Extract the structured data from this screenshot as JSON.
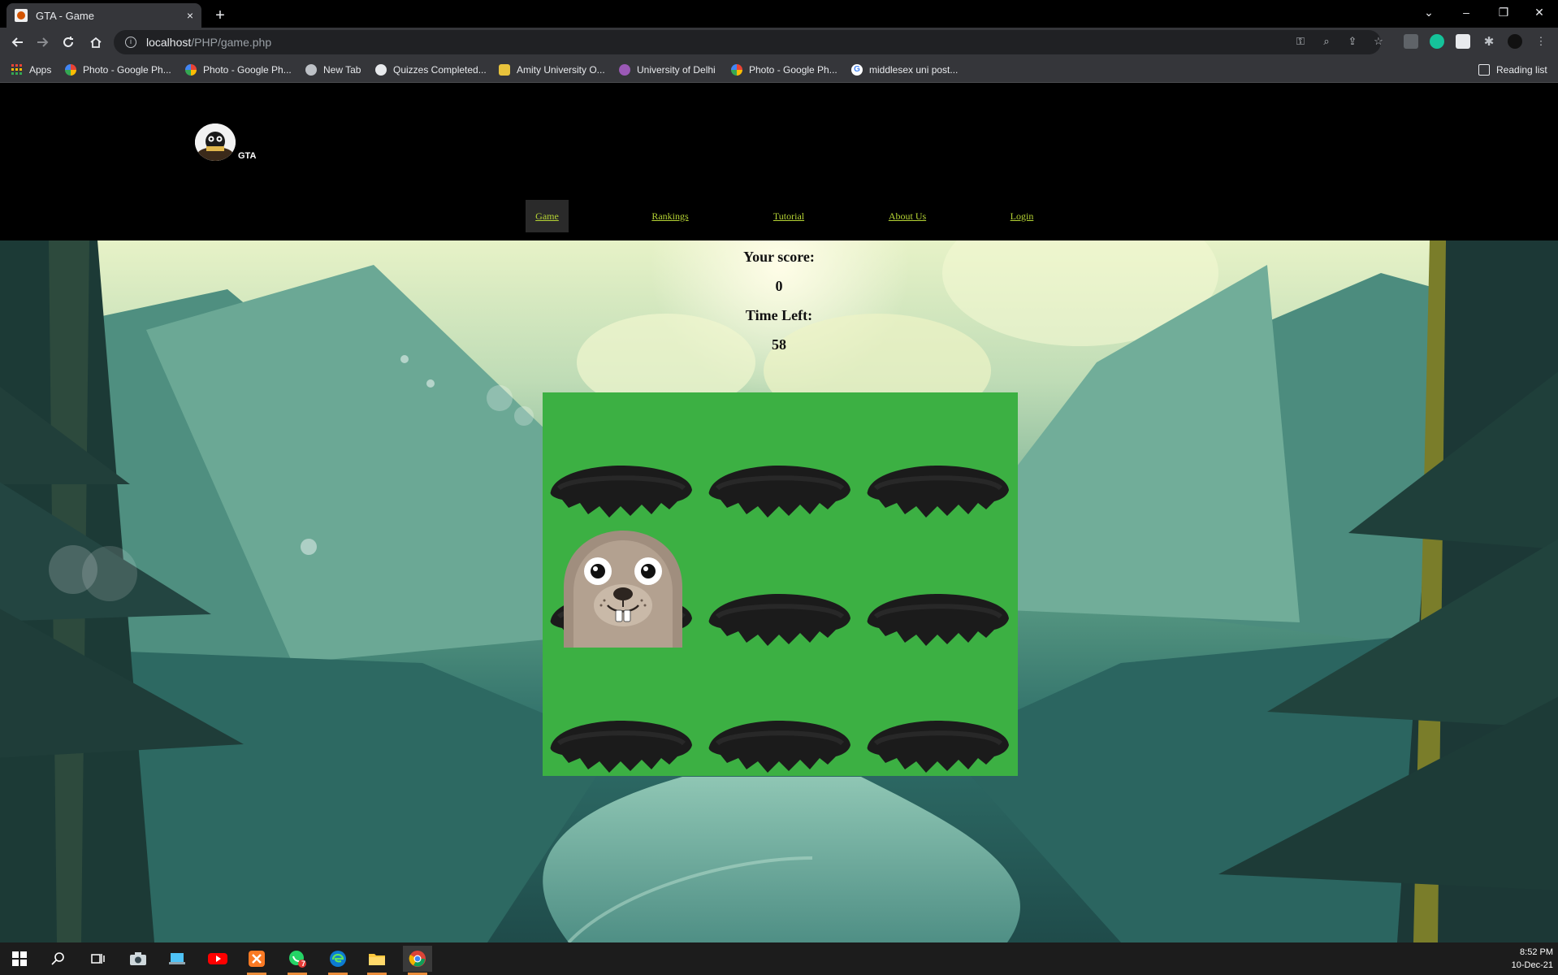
{
  "browser": {
    "tab_title": "GTA - Game",
    "tab_close": "×",
    "new_tab": "+",
    "url_host": "localhost",
    "url_path": "/PHP/game.php",
    "window_controls": [
      "⌄",
      "–",
      "❐",
      "✕"
    ]
  },
  "bookmarks": [
    {
      "label": "Apps",
      "color": "#ea4335"
    },
    {
      "label": "Photo - Google Ph...",
      "color": "#fbbc04"
    },
    {
      "label": "Photo - Google Ph...",
      "color": "#fbbc04"
    },
    {
      "label": "New Tab",
      "color": "#bdc1c6"
    },
    {
      "label": "Quizzes Completed...",
      "color": "#bdc1c6"
    },
    {
      "label": "Amity University O...",
      "color": "#e8c33c"
    },
    {
      "label": "University of Delhi",
      "color": "#9b59b6"
    },
    {
      "label": "Photo - Google Ph...",
      "color": "#fbbc04"
    },
    {
      "label": "middlesex uni post...",
      "color": "#ffffff"
    }
  ],
  "reading_list": "Reading list",
  "site": {
    "name": "GTA",
    "logo_text": "G.T.A.",
    "nav": [
      {
        "label": "Game",
        "active": true
      },
      {
        "label": "Rankings",
        "active": false
      },
      {
        "label": "Tutorial",
        "active": false
      },
      {
        "label": "About Us",
        "active": false
      },
      {
        "label": "Login",
        "active": false
      }
    ]
  },
  "game": {
    "score_label": "Your score:",
    "score": "0",
    "time_label": "Time Left:",
    "time_left": "58",
    "board_color": "#3cb043",
    "holes": 9,
    "mole_hole_index": 3
  },
  "taskbar": {
    "time": "8:52 PM",
    "date": "10-Dec-21",
    "whatsapp_badge": "7"
  }
}
